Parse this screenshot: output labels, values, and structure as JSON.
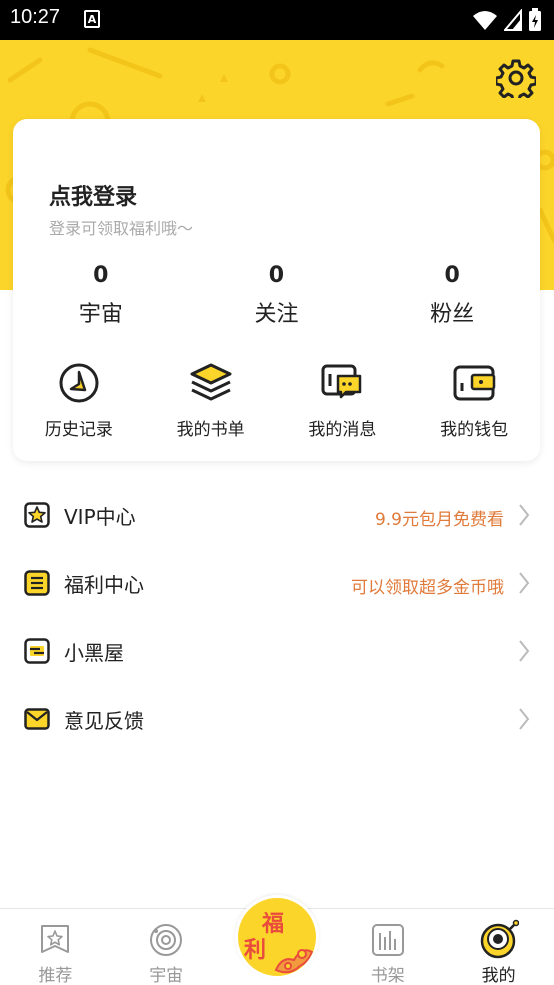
{
  "status_bar": {
    "time": "10:27",
    "notification_icon": "A"
  },
  "header": {
    "settings_icon": "gear-icon"
  },
  "profile": {
    "login_title": "点我登录",
    "login_subtitle": "登录可领取福利哦～",
    "stats": [
      {
        "value": "0",
        "label": "宇宙"
      },
      {
        "value": "0",
        "label": "关注"
      },
      {
        "value": "0",
        "label": "粉丝"
      }
    ],
    "actions": [
      {
        "label": "历史记录",
        "icon": "clock-icon"
      },
      {
        "label": "我的书单",
        "icon": "layers-icon"
      },
      {
        "label": "我的消息",
        "icon": "chat-icon"
      },
      {
        "label": "我的钱包",
        "icon": "wallet-icon"
      }
    ]
  },
  "menu": [
    {
      "label": "VIP中心",
      "note": "9.9元包月免费看",
      "icon": "vip-star-icon"
    },
    {
      "label": "福利中心",
      "note": "可以领取超多金币哦",
      "icon": "list-icon"
    },
    {
      "label": "小黑屋",
      "note": "",
      "icon": "blackroom-icon"
    },
    {
      "label": "意见反馈",
      "note": "",
      "icon": "envelope-icon"
    }
  ],
  "bottom_nav": {
    "tabs": [
      {
        "label": "推荐",
        "icon": "recommend-icon"
      },
      {
        "label": "宇宙",
        "icon": "planet-icon"
      },
      {
        "label": "书架",
        "icon": "bookshelf-icon"
      },
      {
        "label": "我的",
        "icon": "profile-icon",
        "active": true
      }
    ],
    "center_button": {
      "line1": "福",
      "line2": "利"
    }
  },
  "colors": {
    "accent": "#fcd52a",
    "note": "#e07a3a",
    "text": "#222222",
    "muted": "#aaaaaa"
  }
}
